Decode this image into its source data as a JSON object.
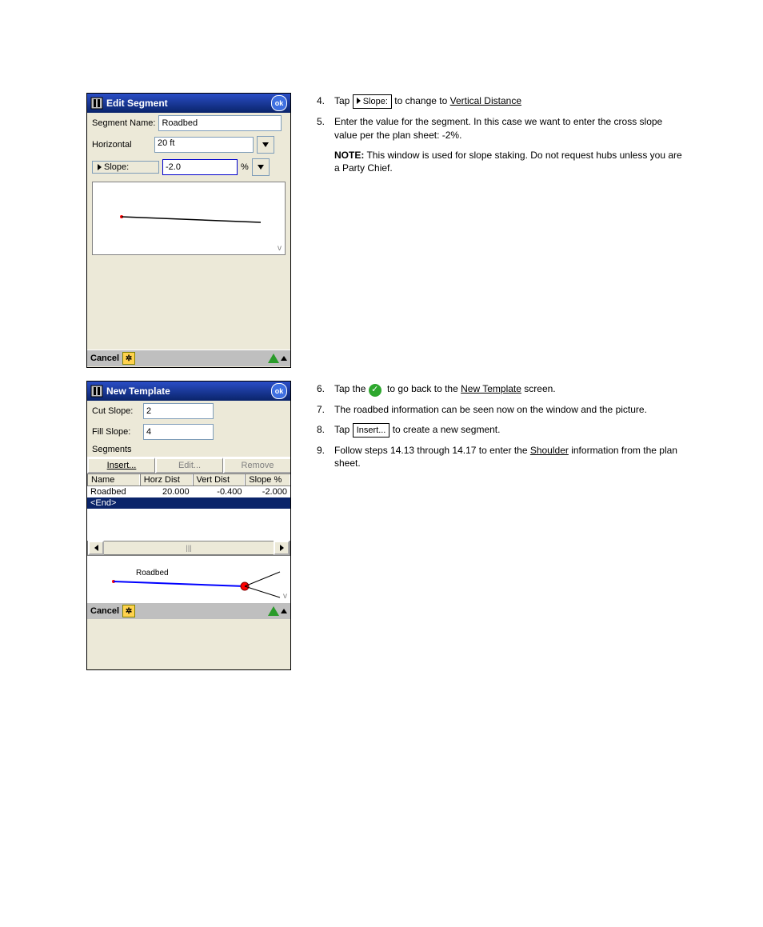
{
  "win1": {
    "title": "Edit Segment",
    "segmentNameLabel": "Segment Name:",
    "segmentName": "Roadbed",
    "horizontalLabel": "Horizontal",
    "horizontalValue": "20 ft",
    "slopeButton": "Slope:",
    "slopeValue": "-2.0",
    "slopeUnit": "%",
    "cornerV": "v",
    "cancel": "Cancel",
    "ok": "ok"
  },
  "win2": {
    "title": "New Template",
    "cutSlopeLabel": "Cut Slope:",
    "cutSlopeValue": "2",
    "fillSlopeLabel": "Fill Slope:",
    "fillSlopeValue": "4",
    "segmentsLabel": "Segments",
    "insert": "Insert...",
    "edit": "Edit...",
    "remove": "Remove",
    "headers": {
      "name": "Name",
      "horz": "Horz Dist",
      "vert": "Vert Dist",
      "slope": "Slope %"
    },
    "row1": {
      "name": "Roadbed",
      "horz": "20.000",
      "vert": "-0.400",
      "slope": "-2.000"
    },
    "row2": {
      "name": "<End>"
    },
    "preview_label": "Roadbed",
    "cornerV": "v",
    "cancel": "Cancel",
    "ok": "ok"
  },
  "text": {
    "step4_pre": "Tap ",
    "step4_btn": "Slope:",
    "step4_mid": " to change to ",
    "step4_link": "Vertical Distance",
    "step5": "Enter the value for the segment.  In this case we want to enter the cross slope value per the plan sheet:  -2%.",
    "noteTitle": "NOTE:",
    "noteBody": "This window is used for slope staking.  Do not request hubs unless you are a Party Chief.",
    "step6_pre": "Tap the ",
    "step6_mid": " to go back to the ",
    "step6_link": "New Template",
    "step6_after": " screen.",
    "step7": "The roadbed information can be seen now on the window and the picture.",
    "step8_pre": "Tap ",
    "step8_btn": "Insert...",
    "step8_after": " to create a new segment.",
    "step9_pre": "Follow steps 14.13 through 14.17 to enter the ",
    "step9_u": "Shoulder",
    "step9_after": " information from the plan sheet."
  }
}
